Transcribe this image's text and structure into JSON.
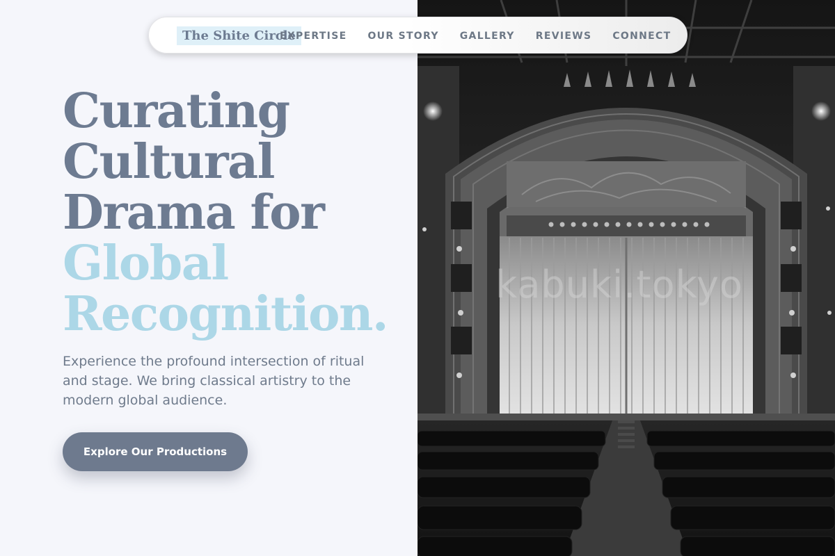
{
  "nav": {
    "brand": "The Shite Circle",
    "links": [
      "EXPERTISE",
      "OUR STORY",
      "GALLERY",
      "REVIEWS",
      "CONNECT"
    ]
  },
  "hero": {
    "headline_dark": [
      "Curating",
      "Cultural",
      "Drama for"
    ],
    "headline_light": [
      "Global",
      "Recognition."
    ],
    "subtext": "Experience the profound intersection of ritual and stage. We bring classical artistry to the modern global audience.",
    "cta_label": "Explore Our Productions"
  },
  "photo": {
    "watermark": "kabuki.tokyo",
    "description_icon": "theater-stage-icon"
  },
  "colors": {
    "accent_dark": "#6d7b91",
    "accent_light": "#acd7e7",
    "background": "#f5f6fb",
    "button": "#6e7a8e",
    "brand_highlight": "#dff0f8"
  }
}
